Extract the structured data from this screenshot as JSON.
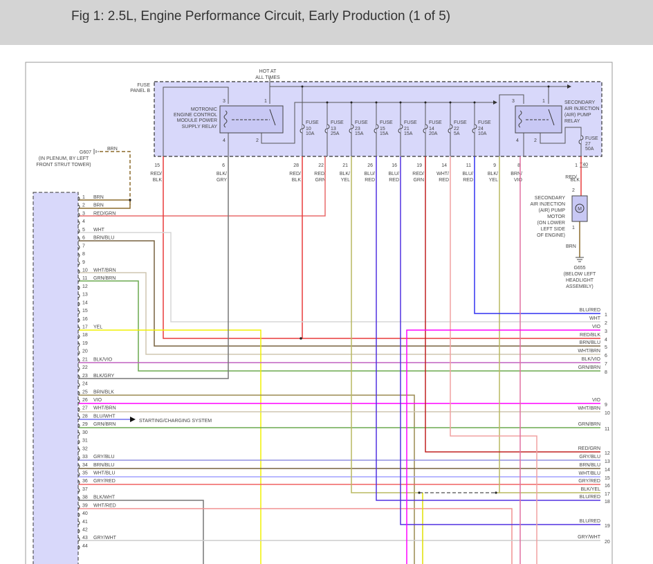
{
  "header": {
    "title": "Fig 1: 2.5L, Engine Performance Circuit, Early Production (1 of 5)"
  },
  "fuse_panel": {
    "label_1": "FUSE",
    "label_2": "PANEL B",
    "hot_1": "HOT AT",
    "hot_2": "ALL TIMES",
    "relay1": [
      "MOTRONIC",
      "ENGINE CONTROL",
      "MODULE POWER",
      "SUPPLY RELAY"
    ],
    "relay1_pins": [
      "3",
      "1",
      "4",
      "2"
    ],
    "relay2": [
      "SECONDARY",
      "AIR INJECTION",
      "(AIR) PUMP",
      "RELAY"
    ],
    "relay2_pins": [
      "3",
      "1",
      "4",
      "2"
    ],
    "fuses": [
      {
        "name": "FUSE",
        "num": "10",
        "amp": "10A"
      },
      {
        "name": "FUSE",
        "num": "13",
        "amp": "25A"
      },
      {
        "name": "FUSE",
        "num": "23",
        "amp": "15A"
      },
      {
        "name": "FUSE",
        "num": "15",
        "amp": "15A"
      },
      {
        "name": "FUSE",
        "num": "21",
        "amp": "15A"
      },
      {
        "name": "FUSE",
        "num": "14",
        "amp": "20A"
      },
      {
        "name": "FUSE",
        "num": "22",
        "amp": "5A"
      },
      {
        "name": "FUSE",
        "num": "24",
        "amp": "10A"
      }
    ],
    "fuse27": {
      "name": "FUSE",
      "num": "27",
      "amp": "50A"
    },
    "connector": "T40",
    "terminals": [
      {
        "num": "15",
        "c1": "RED/",
        "c2": "BLK"
      },
      {
        "num": "6",
        "c1": "BLK/",
        "c2": "GRY"
      },
      {
        "num": "28",
        "c1": "RED/",
        "c2": "BLK"
      },
      {
        "num": "22",
        "c1": "RED/",
        "c2": "GRN"
      },
      {
        "num": "21",
        "c1": "BLK/",
        "c2": "YEL"
      },
      {
        "num": "26",
        "c1": "BLU/",
        "c2": "RED"
      },
      {
        "num": "16",
        "c1": "BLU/",
        "c2": "RED"
      },
      {
        "num": "19",
        "c1": "RED/",
        "c2": "GRN"
      },
      {
        "num": "14",
        "c1": "WHT/",
        "c2": "RED"
      },
      {
        "num": "11",
        "c1": "BLU/",
        "c2": "RED"
      },
      {
        "num": "9",
        "c1": "BLK/",
        "c2": "YEL"
      },
      {
        "num": "8",
        "c1": "BRN/",
        "c2": "VIO"
      },
      {
        "num": "1",
        "c1": "RED/",
        "c2": "BLK"
      }
    ]
  },
  "ground_g607": {
    "id": "G607",
    "loc1": "(IN PLENUM, BY LEFT",
    "loc2": "FRONT STRUT TOWER)",
    "wire": "BRN"
  },
  "motor": {
    "lines": [
      "SECONDARY",
      "AIR INJECTION",
      "(AIR) PUMP",
      "MOTOR",
      "(ON LOWER",
      "LEFT SIDE",
      "OF ENGINE)"
    ],
    "pin_top": "2",
    "pin_bottom": "1",
    "symbol": "M",
    "wire": "BRN"
  },
  "ground_g655": {
    "id": "G655",
    "loc": [
      "(BELOW LEFT",
      "HEADLIGHT",
      "ASSEMBLY)"
    ]
  },
  "starting_charging": "STARTING/CHARGING SYSTEM",
  "left_connector": {
    "pins": [
      {
        "num": "1",
        "color": "BRN"
      },
      {
        "num": "2",
        "color": "BRN"
      },
      {
        "num": "3",
        "color": "RED/GRN"
      },
      {
        "num": "4",
        "color": ""
      },
      {
        "num": "5",
        "color": "WHT"
      },
      {
        "num": "6",
        "color": "BRN/BLU"
      },
      {
        "num": "7",
        "color": ""
      },
      {
        "num": "8",
        "color": ""
      },
      {
        "num": "9",
        "color": ""
      },
      {
        "num": "10",
        "color": "WHT/BRN"
      },
      {
        "num": "11",
        "color": "GRN/BRN"
      },
      {
        "num": "12",
        "color": ""
      },
      {
        "num": "13",
        "color": ""
      },
      {
        "num": "14",
        "color": ""
      },
      {
        "num": "15",
        "color": ""
      },
      {
        "num": "16",
        "color": ""
      },
      {
        "num": "17",
        "color": "YEL"
      },
      {
        "num": "18",
        "color": ""
      },
      {
        "num": "19",
        "color": ""
      },
      {
        "num": "20",
        "color": ""
      },
      {
        "num": "21",
        "color": "BLK/VIO"
      },
      {
        "num": "22",
        "color": ""
      },
      {
        "num": "23",
        "color": "BLK/GRY"
      },
      {
        "num": "24",
        "color": ""
      },
      {
        "num": "25",
        "color": "BRN/BLK"
      },
      {
        "num": "26",
        "color": "VIO"
      },
      {
        "num": "27",
        "color": "WHT/BRN"
      },
      {
        "num": "28",
        "color": "BLU/WHT"
      },
      {
        "num": "29",
        "color": "GRN/BRN"
      },
      {
        "num": "30",
        "color": ""
      },
      {
        "num": "31",
        "color": ""
      },
      {
        "num": "32",
        "color": ""
      },
      {
        "num": "33",
        "color": "GRY/BLU"
      },
      {
        "num": "34",
        "color": "BRN/BLU"
      },
      {
        "num": "35",
        "color": "WHT/BLU"
      },
      {
        "num": "36",
        "color": "GRY/RED"
      },
      {
        "num": "37",
        "color": ""
      },
      {
        "num": "38",
        "color": "BLK/WHT"
      },
      {
        "num": "39",
        "color": "WHT/RED"
      },
      {
        "num": "40",
        "color": ""
      },
      {
        "num": "41",
        "color": ""
      },
      {
        "num": "42",
        "color": ""
      },
      {
        "num": "43",
        "color": "GRY/WHT"
      },
      {
        "num": "44",
        "color": ""
      }
    ]
  },
  "right_connector": {
    "rows": [
      {
        "num": "1",
        "label": "BLU/RED"
      },
      {
        "num": "2",
        "label": "WHT"
      },
      {
        "num": "3",
        "label": "VIO"
      },
      {
        "num": "4",
        "label": "RED/BLK"
      },
      {
        "num": "5",
        "label": "BRN/BLU"
      },
      {
        "num": "6",
        "label": "WHT/BRN"
      },
      {
        "num": "7",
        "label": "BLK/VIO"
      },
      {
        "num": "8",
        "label": "GRN/BRN"
      },
      {
        "num": "9",
        "label": "VIO"
      },
      {
        "num": "10",
        "label": "WHT/BRN"
      },
      {
        "num": "11",
        "label": "GRN/BRN"
      },
      {
        "num": "12",
        "label": "RED/GRN"
      },
      {
        "num": "13",
        "label": "GRY/BLU"
      },
      {
        "num": "14",
        "label": "BRN/BLU"
      },
      {
        "num": "15",
        "label": "WHT/BLU"
      },
      {
        "num": "16",
        "label": "GRY/RED"
      },
      {
        "num": "17",
        "label": "BLK/YEL"
      },
      {
        "num": "18",
        "label": "BLU/RED"
      },
      {
        "num": "19",
        "label": "BLU/RED"
      },
      {
        "num": "20",
        "label": "GRY/WHT"
      }
    ]
  },
  "wire_colors": {
    "RED": "#e83a3a",
    "BRN": "#8b6a2a",
    "WHT": "#d6d6d6",
    "VIO": "#ff00ff",
    "BLU": "#4040e0",
    "YEL": "#f0f000",
    "GRN": "#6aa84f"
  }
}
